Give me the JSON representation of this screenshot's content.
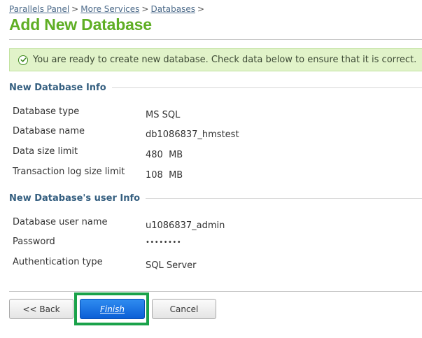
{
  "breadcrumb": {
    "items": [
      "Parallels Panel",
      "More Services",
      "Databases"
    ],
    "separator": ">"
  },
  "page": {
    "title": "Add New Database"
  },
  "notice": {
    "icon": "check-circle-icon",
    "text": "You are ready to create new database. Check data below to ensure that it is correct."
  },
  "db_info": {
    "heading": "New Database Info",
    "rows": [
      {
        "label": "Database type",
        "value": "MS SQL"
      },
      {
        "label": "Database name",
        "value": "db1086837_hmstest"
      },
      {
        "label": "Data size limit",
        "value": "480  MB"
      },
      {
        "label": "Transaction log size limit",
        "value": "108  MB"
      }
    ]
  },
  "user_info": {
    "heading": "New Database's user Info",
    "rows": [
      {
        "label": "Database user name",
        "value": "u1086837_admin"
      },
      {
        "label": "Password",
        "value": "••••••••"
      },
      {
        "label": "Authentication type",
        "value": "SQL Server"
      }
    ]
  },
  "buttons": {
    "back": "<< Back",
    "finish": "Finish",
    "cancel": "Cancel"
  },
  "colors": {
    "title_green": "#5fae24",
    "section_blue": "#355f80",
    "notice_bg": "#e1f3c9",
    "primary_button": "#1a73e8",
    "highlight": "#1aa24a"
  }
}
